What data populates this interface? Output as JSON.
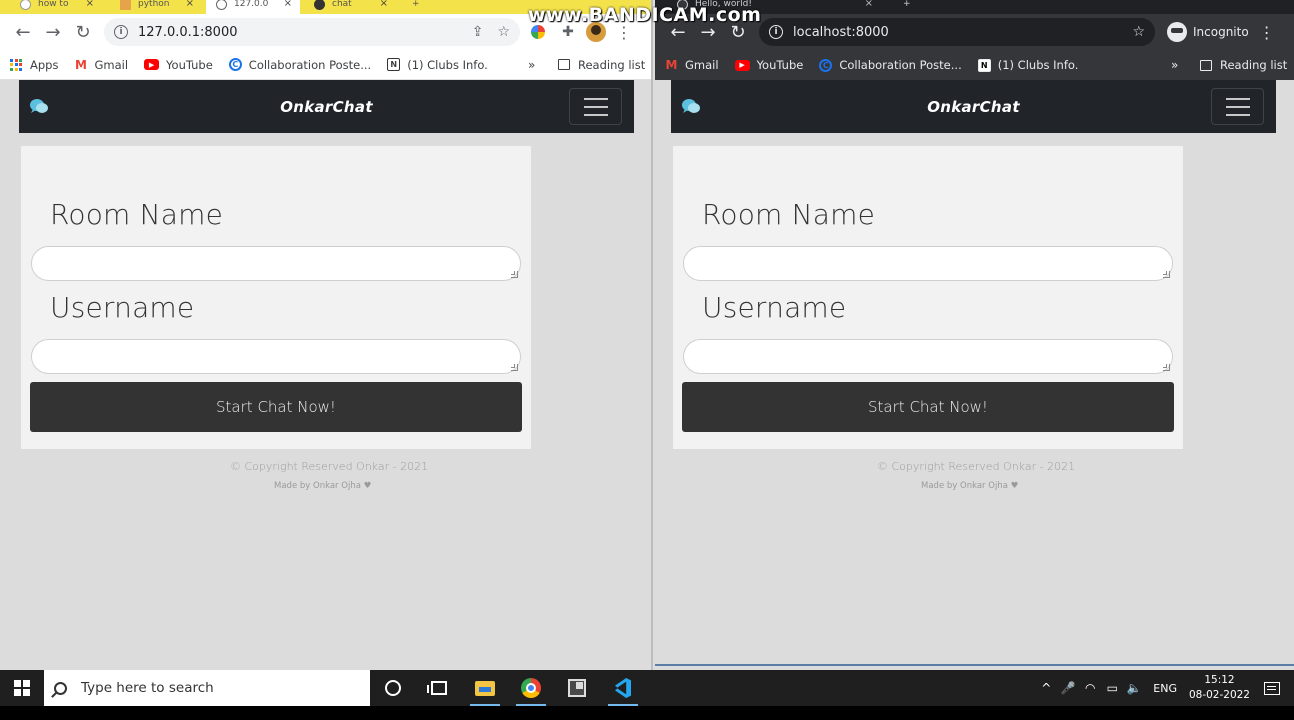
{
  "recording_watermark": "www.BANDICAM.com",
  "left_window": {
    "tabs": [
      {
        "title": "how to"
      },
      {
        "title": "python"
      },
      {
        "title": "127.0.0"
      },
      {
        "title": "chat"
      }
    ],
    "tab_close_glyph": "×",
    "new_tab_glyph": "+",
    "address_url": "127.0.0.1:8000",
    "bookmarks": {
      "apps": "Apps",
      "items": [
        {
          "label": "Gmail",
          "icon": "gmail-icon"
        },
        {
          "label": "YouTube",
          "icon": "youtube-icon"
        },
        {
          "label": "Collaboration Poste...",
          "icon": "collaboration-icon"
        },
        {
          "label": "(1) Clubs Info.",
          "icon": "notion-icon"
        }
      ],
      "more": "»",
      "reading_list": "Reading list"
    },
    "page": {
      "brand": "OnkarChat",
      "room_label": "Room Name",
      "username_label": "Username",
      "button_label": "Start Chat Now!",
      "footer_copyright": "© Copyright Reserved Onkar - 2021",
      "footer_made_by": "Made by Onkar Ojha ♥"
    }
  },
  "right_window": {
    "tabs": [
      {
        "title": "Hello, world!"
      }
    ],
    "tab_close_glyph": "×",
    "new_tab_glyph": "+",
    "address_url": "localhost:8000",
    "incognito_label": "Incognito",
    "bookmarks": {
      "items": [
        {
          "label": "Gmail",
          "icon": "gmail-icon"
        },
        {
          "label": "YouTube",
          "icon": "youtube-icon"
        },
        {
          "label": "Collaboration Poste...",
          "icon": "collaboration-icon"
        },
        {
          "label": "(1) Clubs Info.",
          "icon": "notion-icon"
        }
      ],
      "more": "»",
      "reading_list": "Reading list"
    },
    "page": {
      "brand": "OnkarChat",
      "room_label": "Room Name",
      "username_label": "Username",
      "button_label": "Start Chat Now!",
      "footer_copyright": "© Copyright Reserved Onkar - 2021",
      "footer_made_by": "Made by Onkar Ojha ♥"
    }
  },
  "taskbar": {
    "search_placeholder": "Type here to search",
    "language": "ENG",
    "time": "15:12",
    "date": "08-02-2022"
  },
  "icons": {
    "back": "←",
    "forward": "→",
    "reload": "↻",
    "info": "i",
    "share": "⇪",
    "star": "☆",
    "extensions": "✚",
    "menu": "⋮",
    "tray_chevron": "^",
    "mic": "🎤",
    "wifi": "◠",
    "battery": "▭",
    "volume": "🔈"
  },
  "colors": {
    "navbar_bg": "#212529",
    "button_bg": "#333333",
    "card_bg": "#f2f2f2",
    "page_bg": "#dcdcdc"
  }
}
